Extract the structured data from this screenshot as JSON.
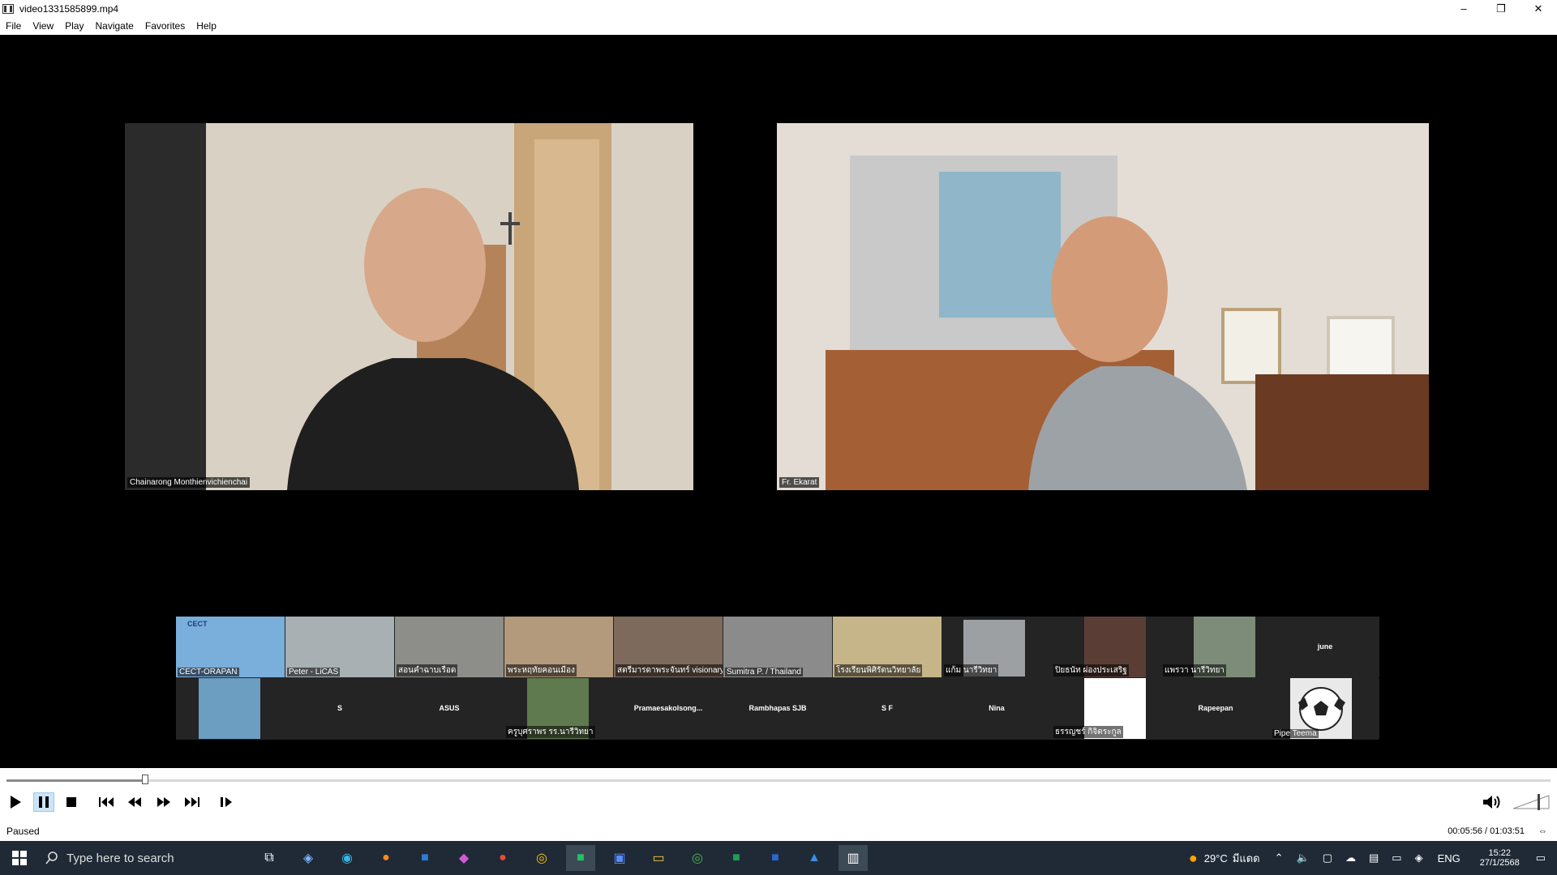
{
  "window": {
    "title": "video1331585899.mp4",
    "minimize": "–",
    "restore": "❐",
    "close": "✕"
  },
  "menu": [
    "File",
    "View",
    "Play",
    "Navigate",
    "Favorites",
    "Help"
  ],
  "speakers": [
    {
      "name": "Chainarong Monthienvichienchai"
    },
    {
      "name": "Fr. Ekarat"
    }
  ],
  "participants_row1": [
    {
      "name": "CECT-ORAPAN",
      "logo": "CECT"
    },
    {
      "name": "Peter - LiCAS"
    },
    {
      "name": "สอนคำฉาบเรือด"
    },
    {
      "name": "พระหฤทัยคอนเมือง"
    },
    {
      "name": "สตรีมารดาพระจันทร์ visionary"
    },
    {
      "name": "Sumitra P. / Thailand"
    },
    {
      "name": "โรงเรียนพิศิรัตนวิทยาลัย"
    },
    {
      "name": "แก้ม นารีวิทยา"
    },
    {
      "name": "ปิยธนัท ผ่องประเสริฐ"
    },
    {
      "name": "แพรวา นารีวิทยา"
    },
    {
      "name": "june"
    }
  ],
  "participants_row2": [
    {
      "name": ""
    },
    {
      "name": "S"
    },
    {
      "name": "ASUS"
    },
    {
      "name": "ครูบุศราพร รร.นารีวิทยา"
    },
    {
      "name": "Pramaesakolsong..."
    },
    {
      "name": "Rambhapas SJB"
    },
    {
      "name": "S F"
    },
    {
      "name": "Nina"
    },
    {
      "name": "ธรรญชร์ กิจิตระกูล"
    },
    {
      "name": "Rapeepan"
    },
    {
      "name": "Pipe Teema"
    }
  ],
  "player": {
    "progress": 0.09,
    "status": "Paused",
    "time": "00:05:56 / 01:03:51"
  },
  "taskbar": {
    "search_placeholder": "Type here to search",
    "temperature": "29°C",
    "weather": "มีแดด",
    "lang": "ENG",
    "time": "15:22",
    "date": "27/1/2568"
  },
  "colors": {
    "taskbar_bg": "#1f2a36",
    "active_btn": "#cce4f7",
    "thumb_bg": "#242424"
  }
}
